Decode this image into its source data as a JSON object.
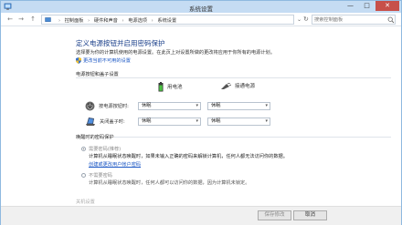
{
  "window": {
    "title": "系统设置",
    "controls": {
      "minimize": "—",
      "maximize": "□",
      "close": "✕"
    }
  },
  "address_bar": {
    "breadcrumbs": [
      "控制面板",
      "硬件和声音",
      "电源选项",
      "系统设置"
    ],
    "search_placeholder": "搜索控制面板"
  },
  "page": {
    "heading": "定义电源按钮并启用密码保护",
    "description": "选择要为你的计算机使用的电源设置。在此页上对设置所做的更改将应用于你所有的电源计划。",
    "change_settings_link": "更改当前不可用的设置"
  },
  "power_buttons": {
    "section_title": "电源按钮和盖子设置",
    "columns": [
      {
        "label": "用电池",
        "icon": "battery-icon"
      },
      {
        "label": "接通电源",
        "icon": "plug-icon"
      }
    ],
    "rows": [
      {
        "label": "按电源按钮时:",
        "icon": "power-button-icon",
        "battery_value": "休眠",
        "plugged_value": "休眠"
      },
      {
        "label": "关闭盖子时:",
        "icon": "lid-icon",
        "battery_value": "休眠",
        "plugged_value": "休眠"
      }
    ]
  },
  "wake_password": {
    "section_title": "唤醒时的密码保护",
    "options": [
      {
        "label": "需要密码(推荐)",
        "selected": true,
        "description": "计算机从睡眠状态唤醒时，如果未输入正确的密码来解锁计算机，任何人都无法访问你的数据。",
        "link": "创建或更改用户帐户密码"
      },
      {
        "label": "不需要密码",
        "selected": false,
        "description": "计算机从睡眠状态唤醒时，任何人都可以访问你的数据，因为计算机未锁定。"
      }
    ]
  },
  "shutdown_section": {
    "title": "关机设置"
  },
  "footer": {
    "save_label": "保存修改",
    "cancel_label": "取消"
  },
  "colors": {
    "heading": "#1a3f8a",
    "link": "#1a56c4",
    "titlebar": "#c5dcf3",
    "close_button": "#c7504a"
  }
}
